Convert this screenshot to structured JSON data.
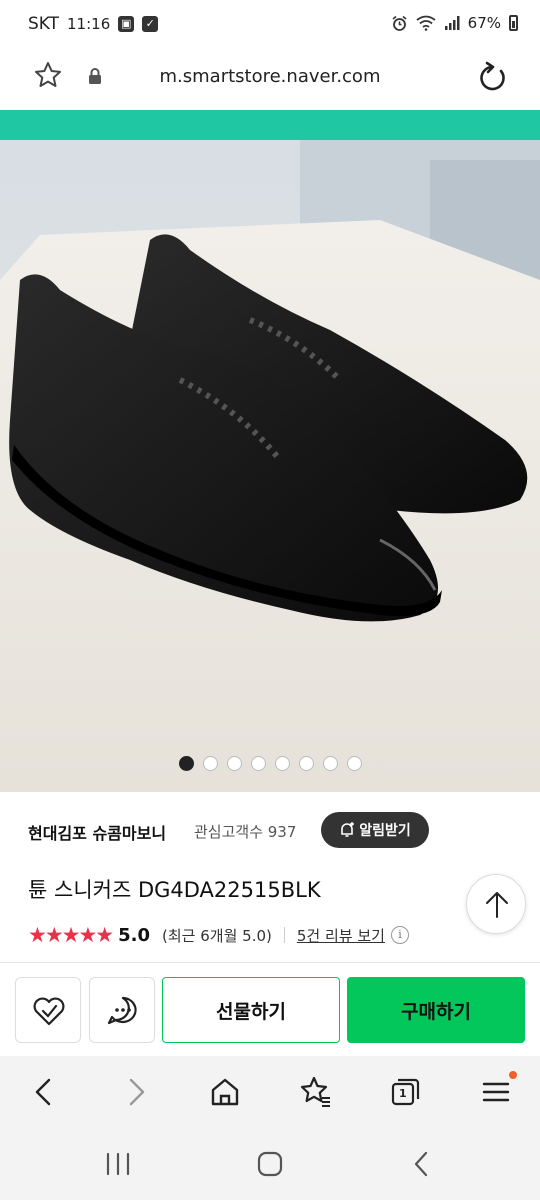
{
  "status_bar": {
    "carrier": "SKT",
    "time": "11:16",
    "battery": "67%"
  },
  "url_bar": {
    "url": "m.smartstore.naver.com"
  },
  "product_gallery": {
    "image_description": "black sneakers",
    "total_images": 8,
    "current_index": 1
  },
  "store": {
    "name": "현대김포 슈콤마보니",
    "followers": "관심고객수 937",
    "alarm_label": "알림받기"
  },
  "product": {
    "name": "튠 스니커즈 DG4DA22515BLK",
    "rating": 5,
    "rating_text": "5.0",
    "recent_rating": "(최근 6개월 5.0)",
    "review_link": "5건 리뷰 보기",
    "info_glyph": "i"
  },
  "actions": {
    "gift_label": "선물하기",
    "buy_label": "구매하기"
  },
  "browser_toolbar": {
    "tab_count": "1"
  },
  "colors": {
    "accent_green": "#03c75a",
    "teal": "#1fc7a3",
    "star_red": "#e8324a"
  }
}
